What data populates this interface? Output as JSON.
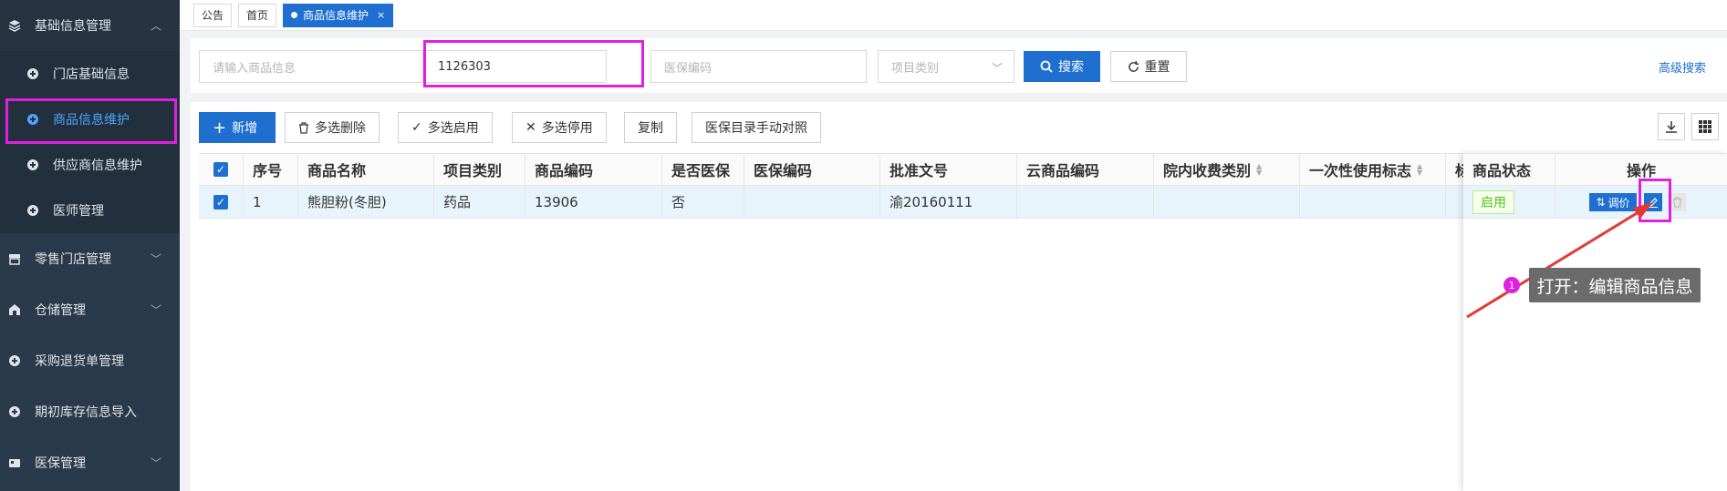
{
  "sidebar": {
    "group_basic": "基础信息管理",
    "sub_items": [
      {
        "label": "门店基础信息"
      },
      {
        "label": "商品信息维护"
      },
      {
        "label": "供应商信息维护"
      },
      {
        "label": "医师管理"
      }
    ],
    "groups": [
      {
        "label": "零售门店管理"
      },
      {
        "label": "仓储管理"
      },
      {
        "label": "采购退货单管理"
      },
      {
        "label": "期初库存信息导入"
      },
      {
        "label": "医保管理"
      }
    ]
  },
  "tabs": [
    {
      "label": "公告"
    },
    {
      "label": "首页"
    },
    {
      "label": "商品信息维护",
      "close": "×"
    }
  ],
  "search": {
    "product_placeholder": "请输入商品信息",
    "code_value": "1126303",
    "insurance_placeholder": "医保编码",
    "category_placeholder": "项目类别",
    "search_label": "搜索",
    "reset_label": "重置",
    "advanced_label": "高级搜索"
  },
  "toolbar": {
    "add": "新增",
    "batch_delete": "多选删除",
    "batch_enable": "多选启用",
    "batch_disable": "多选停用",
    "copy": "复制",
    "insurance_match": "医保目录手动对照"
  },
  "table": {
    "headers": [
      "序号",
      "商品名称",
      "项目类别",
      "商品编码",
      "是否医保",
      "医保编码",
      "批准文号",
      "云商品编码",
      "院内收费类别",
      "一次性使用标志",
      "标"
    ],
    "fixed_headers": [
      "商品状态",
      "操作"
    ],
    "rows": [
      {
        "cells": [
          "1",
          "熊胆粉(冬胆)",
          "药品",
          "13906",
          "否",
          "",
          "渝20160111",
          "",
          "",
          "",
          ""
        ],
        "status": "启用",
        "adjust_label": "调价"
      }
    ]
  },
  "annotation": {
    "number": "1",
    "text": "打开：编辑商品信息"
  },
  "colors": {
    "primary": "#1e6fd0",
    "highlight": "#e020e0",
    "arrow": "#e53935",
    "sidebar_bg": "#2b3a4a"
  }
}
